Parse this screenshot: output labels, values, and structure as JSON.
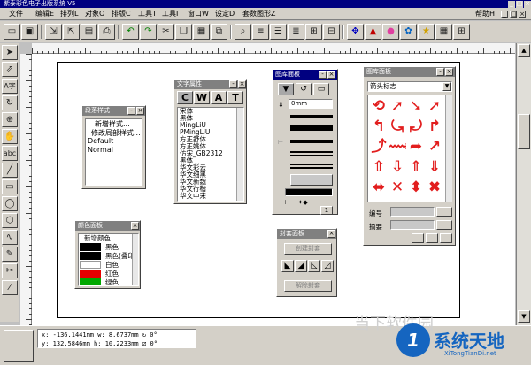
{
  "app": {
    "title": "紫泰彩色电子出版系统 V5"
  },
  "menu": {
    "items": [
      "文件",
      "编辑E",
      "排列L",
      "对象O",
      "排版C",
      "工具T",
      "工具I",
      "窗口W",
      "设定D",
      "套数图形Z"
    ],
    "help": "帮助H"
  },
  "toolbar": {
    "icons": [
      "new-icon",
      "save-icon",
      "import-icon",
      "export-icon",
      "image-icon",
      "print-icon",
      "undo-icon",
      "redo-icon",
      "cut-icon",
      "copy-icon",
      "paste-icon",
      "link-icon",
      "find-icon",
      "align-left-icon",
      "align-center-icon",
      "align-right-icon",
      "zoom-icon",
      "measure-icon",
      "node-icon",
      "layer-icon",
      "color-icon",
      "symbol-icon",
      "star-icon",
      "table-icon",
      "grid-icon"
    ]
  },
  "tools": {
    "icons": [
      "select-arrow-icon",
      "node-arrow-icon",
      "text-tool-icon",
      "rotate-icon",
      "zoom-tool-icon",
      "hand-icon",
      "text-block-icon",
      "line-tool-icon",
      "rect-tool-icon",
      "ellipse-tool-icon",
      "polygon-tool-icon",
      "bezier-tool-icon",
      "pen-tool-icon",
      "scissors-icon",
      "eyedropper-icon"
    ],
    "labels": {
      "text": "A字",
      "abc": "abc"
    }
  },
  "style_panel": {
    "title": "段落样式",
    "items": [
      "新增样式...",
      "修改局部样式...",
      "Default",
      "Normal"
    ]
  },
  "font_panel": {
    "title": "文字属性",
    "tabs": [
      "C",
      "W",
      "A",
      "T"
    ],
    "fonts": [
      "宋体",
      "黑体",
      "MingLiU",
      "PMingLiU",
      "方正舒体",
      "方正姚体",
      "仿宋_GB2312",
      "黑体",
      "华文彩云",
      "华文细黑",
      "华文新魏",
      "华文行楷",
      "华文中宋"
    ]
  },
  "color_panel": {
    "title": "颜色面板",
    "items": [
      {
        "label": "新增颜色...",
        "swatch": ""
      },
      {
        "label": "黑色",
        "swatch": "#000000"
      },
      {
        "label": "黑色(叠印)",
        "swatch": "#000000"
      },
      {
        "label": "白色",
        "swatch": "#ffffff"
      },
      {
        "label": "红色",
        "swatch": "#e60000"
      },
      {
        "label": "绿色",
        "swatch": "#00a800"
      }
    ]
  },
  "line_panel": {
    "title": "图库面板",
    "width_value": "0mm",
    "button_label": "1"
  },
  "envelope_panel": {
    "title": "封套面板",
    "create_label": "创建封套",
    "release_label": "解除封套"
  },
  "symbol_panel": {
    "title": "图库面板",
    "category": "箭头标志",
    "number_label": "编号",
    "summary_label": "摘要",
    "symbols": [
      "⟲",
      "➚",
      "➘",
      "➚",
      "↰",
      "⤿",
      "⤾",
      "↱",
      "⤴",
      "⟿",
      "➦",
      "↗",
      "⇧",
      "⇩",
      "⇑",
      "⇓",
      "⬌",
      "✕",
      "⬍",
      "✖"
    ]
  },
  "status": {
    "x_label": "x:",
    "x_value": "-136.1441mm",
    "w_label": "w:",
    "w_value": "8.6737mm",
    "y_label": "y:",
    "y_value": "132.5846mm",
    "h_label": "h:",
    "h_value": "10.2233mm",
    "rotate_value": "0°",
    "skew_value": "0°"
  },
  "watermark": {
    "left_text": "当下软件园",
    "brand_text": "系统天地",
    "brand_url": "XiTongTianDi.net"
  },
  "colors": {
    "titlebar": "#000080",
    "chrome": "#d4d0c8",
    "symbol_red": "#e21e1e",
    "brand_blue": "#1565c0"
  }
}
